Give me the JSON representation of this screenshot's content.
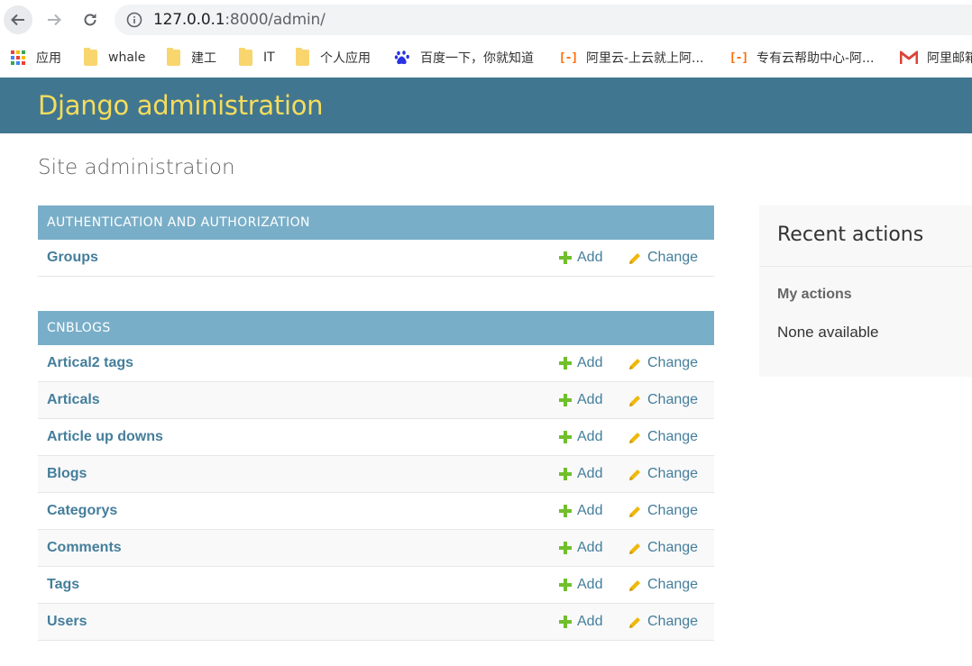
{
  "browser": {
    "url_host": "127.0.0.1",
    "url_rest": ":8000/admin/",
    "bookmarks": [
      {
        "label": "应用",
        "icon": "apps-grid-icon"
      },
      {
        "label": "whale",
        "icon": "folder-icon"
      },
      {
        "label": "建工",
        "icon": "folder-icon"
      },
      {
        "label": "IT",
        "icon": "folder-icon"
      },
      {
        "label": "个人应用",
        "icon": "folder-icon"
      },
      {
        "label": "百度一下，你就知道",
        "icon": "baidu-paw-icon"
      },
      {
        "label": "阿里云-上云就上阿...",
        "icon": "aliyun-icon"
      },
      {
        "label": "专有云帮助中心-阿...",
        "icon": "aliyun-icon"
      },
      {
        "label": "阿里邮箱",
        "icon": "gmail-m-icon"
      }
    ]
  },
  "header": {
    "branding": "Django administration"
  },
  "page": {
    "title": "Site administration"
  },
  "modules": [
    {
      "caption": "AUTHENTICATION AND AUTHORIZATION",
      "models": [
        {
          "name": "Groups",
          "add": "Add",
          "change": "Change"
        }
      ]
    },
    {
      "caption": "CNBLOGS",
      "models": [
        {
          "name": "Artical2 tags",
          "add": "Add",
          "change": "Change"
        },
        {
          "name": "Articals",
          "add": "Add",
          "change": "Change"
        },
        {
          "name": "Article up downs",
          "add": "Add",
          "change": "Change"
        },
        {
          "name": "Blogs",
          "add": "Add",
          "change": "Change"
        },
        {
          "name": "Categorys",
          "add": "Add",
          "change": "Change"
        },
        {
          "name": "Comments",
          "add": "Add",
          "change": "Change"
        },
        {
          "name": "Tags",
          "add": "Add",
          "change": "Change"
        },
        {
          "name": "Users",
          "add": "Add",
          "change": "Change"
        }
      ]
    }
  ],
  "recent_actions": {
    "title": "Recent actions",
    "subtitle": "My actions",
    "empty": "None available"
  },
  "colors": {
    "header_bg": "#417690",
    "branding": "#f5dd5d",
    "caption_bg": "#79aec8",
    "link": "#447e9b",
    "add_icon": "#70bf2b"
  }
}
